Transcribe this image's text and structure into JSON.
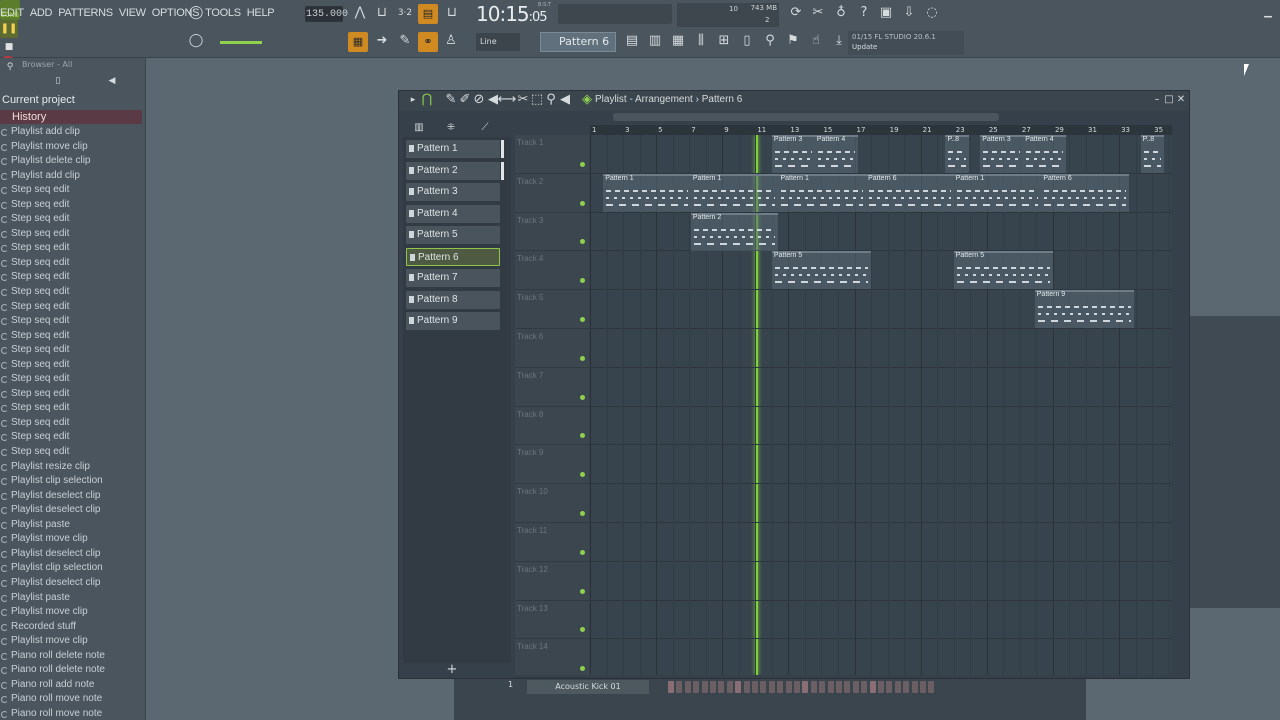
{
  "menu": [
    "EDIT",
    "ADD",
    "PATTERNS",
    "VIEW",
    "OPTIONS",
    "TOOLS",
    "HELP"
  ],
  "transport": {
    "mode": "SONG",
    "tempo": "135.000",
    "time": "10:15",
    "time_frac": "05",
    "time_sub": "B:S:T"
  },
  "cpu": {
    "value": "10",
    "memory": "743 MB",
    "polyphony": "2"
  },
  "snap": "Line",
  "pattern_selector": "Pattern 6",
  "hint": {
    "line1": "01/15  FL STUDIO 20.6.1",
    "line2": "Update"
  },
  "browser": {
    "title": "Browser - All",
    "current_project": "Current project",
    "history_label": "History",
    "history": [
      "Playlist add clip",
      "Playlist move clip",
      "Playlist delete clip",
      "Playlist add clip",
      "Step seq edit",
      "Step seq edit",
      "Step seq edit",
      "Step seq edit",
      "Step seq edit",
      "Step seq edit",
      "Step seq edit",
      "Step seq edit",
      "Step seq edit",
      "Step seq edit",
      "Step seq edit",
      "Step seq edit",
      "Step seq edit",
      "Step seq edit",
      "Step seq edit",
      "Step seq edit",
      "Step seq edit",
      "Step seq edit",
      "Step seq edit",
      "Playlist resize clip",
      "Playlist clip selection",
      "Playlist deselect clip",
      "Playlist deselect clip",
      "Playlist paste",
      "Playlist move clip",
      "Playlist deselect clip",
      "Playlist clip selection",
      "Playlist deselect clip",
      "Playlist paste",
      "Playlist move clip",
      "Recorded stuff",
      "Playlist move clip",
      "Piano roll delete note",
      "Piano roll delete note",
      "Piano roll add note",
      "Piano roll move note",
      "Piano roll move note"
    ]
  },
  "playlist": {
    "title": "Playlist - Arrangement",
    "current_pattern": "Pattern 6",
    "patterns": [
      "Pattern 1",
      "Pattern 2",
      "Pattern 3",
      "Pattern 4",
      "Pattern 5",
      "Pattern 6",
      "Pattern 7",
      "Pattern 8",
      "Pattern 9"
    ],
    "selected_pattern_index": 5,
    "tracks": [
      "Track 1",
      "Track 2",
      "Track 3",
      "Track 4",
      "Track 5",
      "Track 6",
      "Track 7",
      "Track 8",
      "Track 9",
      "Track 10",
      "Track 11",
      "Track 12",
      "Track 13",
      "Track 14"
    ],
    "ruler": [
      "1",
      "3",
      "5",
      "7",
      "9",
      "11",
      "13",
      "15",
      "17",
      "19",
      "21",
      "23",
      "25",
      "27",
      "29",
      "31",
      "33",
      "35"
    ],
    "clips": [
      {
        "track": 1,
        "label": "Pattern 3",
        "start": 12,
        "len": 2.6
      },
      {
        "track": 1,
        "label": "Pattern 4",
        "start": 14.6,
        "len": 2.6
      },
      {
        "track": 1,
        "label": "P..8",
        "start": 22.5,
        "len": 1.4
      },
      {
        "track": 1,
        "label": "Pattern 3",
        "start": 24.6,
        "len": 2.6
      },
      {
        "track": 1,
        "label": "Pattern 4",
        "start": 27.2,
        "len": 2.6
      },
      {
        "track": 1,
        "label": "P..8",
        "start": 34.3,
        "len": 1.4
      },
      {
        "track": 2,
        "label": "Pattern 1",
        "start": 1.8,
        "len": 5.3
      },
      {
        "track": 2,
        "label": "Pattern 1",
        "start": 7.1,
        "len": 5.3
      },
      {
        "track": 2,
        "label": "Pattern 1",
        "start": 12.4,
        "len": 5.3
      },
      {
        "track": 2,
        "label": "Pattern 6",
        "start": 17.7,
        "len": 5.3
      },
      {
        "track": 2,
        "label": "Pattern 1",
        "start": 23.0,
        "len": 5.3
      },
      {
        "track": 2,
        "label": "Pattern 6",
        "start": 28.3,
        "len": 5.3
      },
      {
        "track": 3,
        "label": "Pattern 2",
        "start": 7.1,
        "len": 5.3
      },
      {
        "track": 4,
        "label": "Pattern 5",
        "start": 12.0,
        "len": 6.0
      },
      {
        "track": 4,
        "label": "Pattern 5",
        "start": 23.0,
        "len": 6.0
      },
      {
        "track": 5,
        "label": "Pattern 9",
        "start": 27.9,
        "len": 6.0
      }
    ]
  },
  "channel_rack": {
    "channel_number": "1",
    "channel_name": "Acoustic Kick 01"
  },
  "colors": {
    "playhead": "#7fd23a",
    "record": "#c0383d",
    "accent_orange": "#d08a22",
    "selected_pattern": "#8fc54a"
  }
}
